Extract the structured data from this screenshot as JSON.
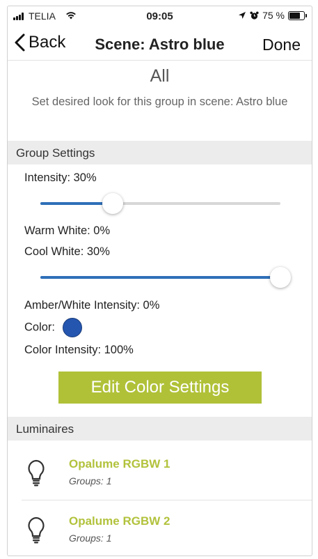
{
  "status_bar": {
    "carrier": "TELIA",
    "time": "09:05",
    "battery_text": "75 %",
    "battery_level": 0.75
  },
  "nav": {
    "back_label": "Back",
    "title": "Scene: Astro blue",
    "done_label": "Done"
  },
  "header": {
    "group_name": "All",
    "description": "Set desired look for this group in scene: Astro blue"
  },
  "group_settings": {
    "section_title": "Group Settings",
    "intensity_label": "Intensity: 30%",
    "intensity_value": 0.3,
    "warm_white_label": "Warm White: 0%",
    "cool_white_label": "Cool White: 30%",
    "white_slider_value": 1.0,
    "amber_label": "Amber/White Intensity: 0%",
    "color_label": "Color:",
    "color_value": "#2456b0",
    "color_intensity_label": "Color Intensity: 100%",
    "edit_color_button": "Edit Color Settings"
  },
  "luminaires": {
    "section_title": "Luminaires",
    "items": [
      {
        "name": "Opalume RGBW 1",
        "groups": "Groups: 1"
      },
      {
        "name": "Opalume RGBW 2",
        "groups": "Groups: 1"
      }
    ]
  },
  "colors": {
    "accent_green": "#b0c138",
    "slider_blue": "#2e6fb8"
  }
}
